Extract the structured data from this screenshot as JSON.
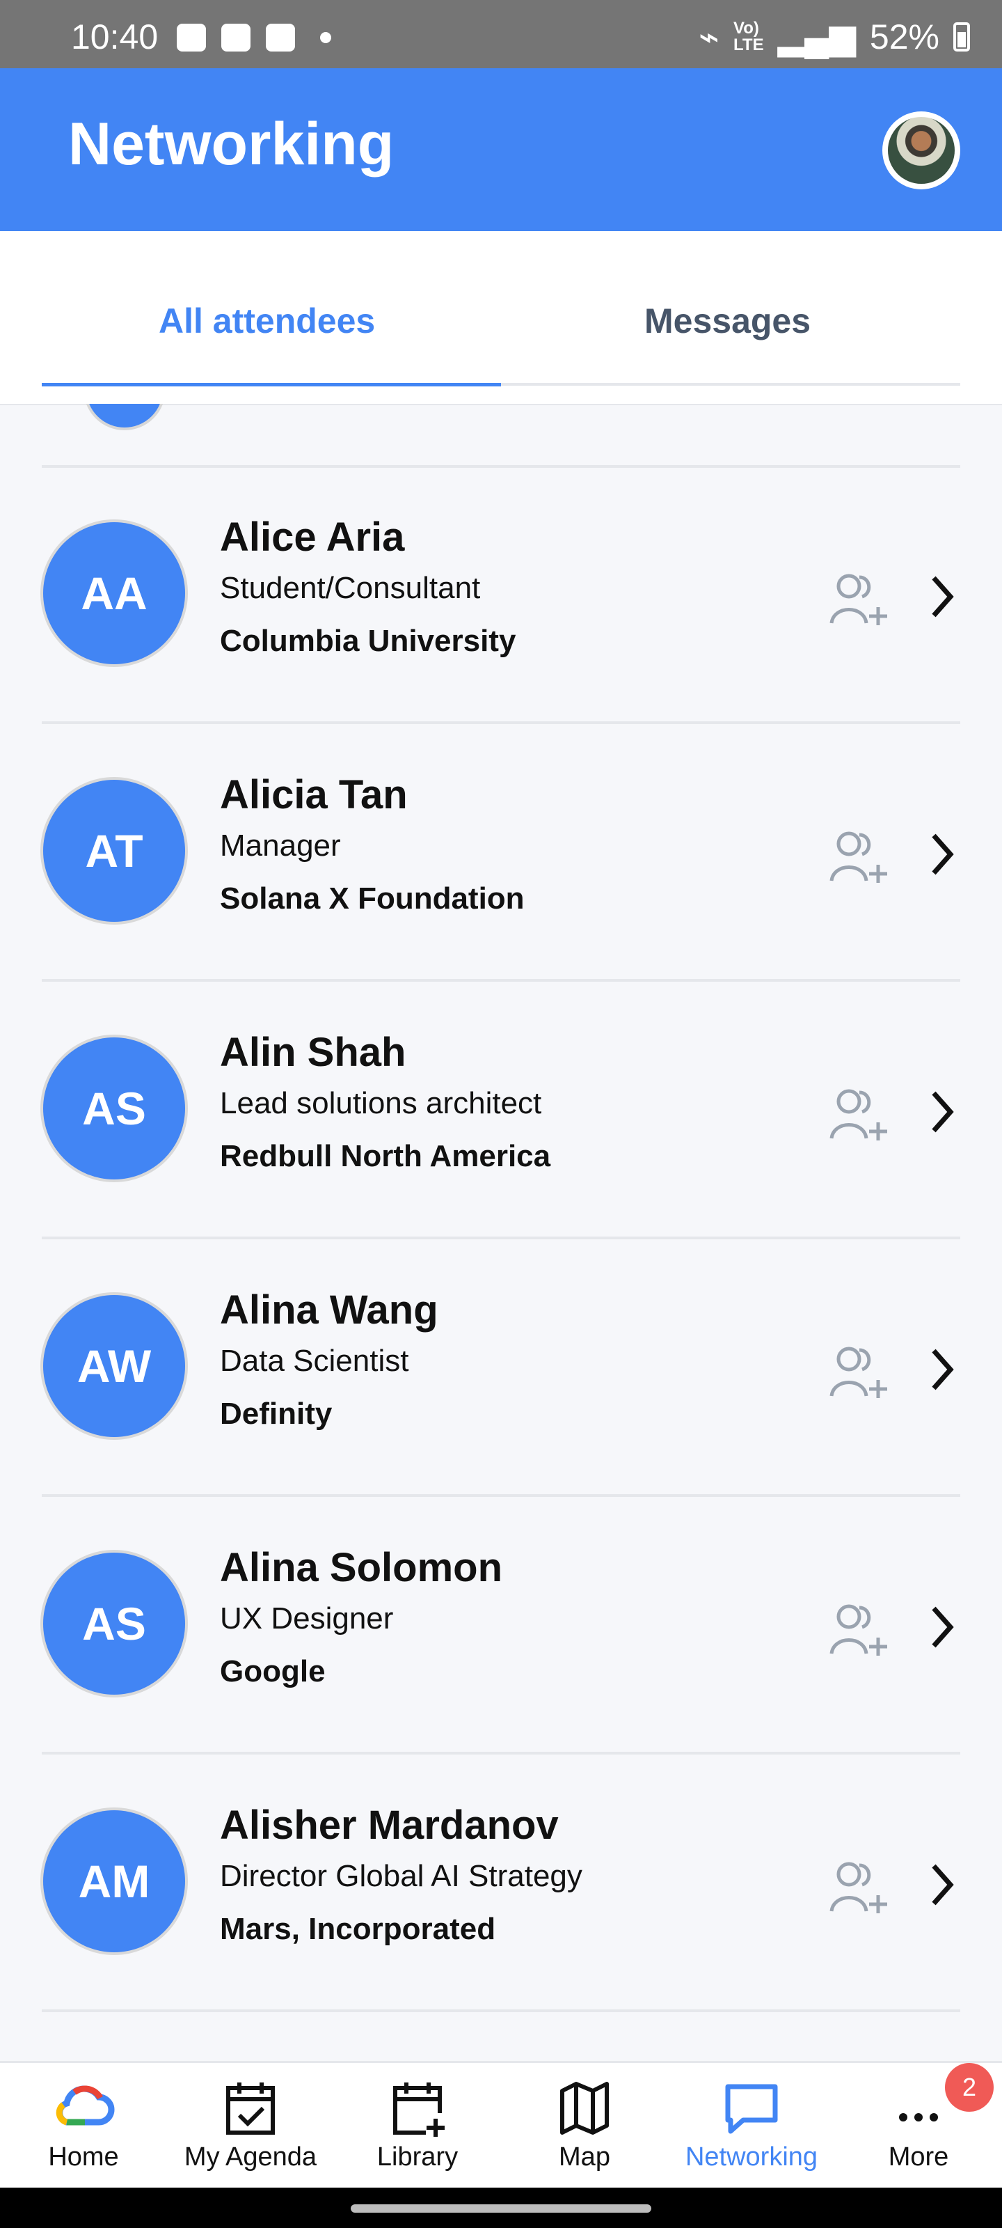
{
  "status_bar": {
    "time": "10:40",
    "battery": "52%"
  },
  "header": {
    "title": "Networking"
  },
  "tabs": [
    {
      "label": "All attendees",
      "active": true
    },
    {
      "label": "Messages",
      "active": false
    }
  ],
  "attendees": [
    {
      "initials": "AA",
      "name": "Alice Aria",
      "title": "Student/Consultant",
      "company": "Columbia University"
    },
    {
      "initials": "AT",
      "name": "Alicia Tan",
      "title": "Manager",
      "company": "Solana X Foundation"
    },
    {
      "initials": "AS",
      "name": "Alin Shah",
      "title": "Lead solutions architect",
      "company": "Redbull North America"
    },
    {
      "initials": "AW",
      "name": "Alina Wang",
      "title": "Data Scientist",
      "company": "Definity"
    },
    {
      "initials": "AS",
      "name": "Alina Solomon",
      "title": "UX Designer",
      "company": "Google"
    },
    {
      "initials": "AM",
      "name": "Alisher Mardanov",
      "title": "Director Global AI Strategy",
      "company": "Mars, Incorporated"
    }
  ],
  "bottom_nav": [
    {
      "label": "Home",
      "icon": "google-cloud-icon"
    },
    {
      "label": "My Agenda",
      "icon": "calendar-check-icon"
    },
    {
      "label": "Library",
      "icon": "calendar-plus-icon"
    },
    {
      "label": "Map",
      "icon": "map-icon"
    },
    {
      "label": "Networking",
      "icon": "chat-bubble-icon",
      "active": true
    },
    {
      "label": "More",
      "icon": "more-dots-icon",
      "badge": "2"
    }
  ],
  "colors": {
    "primary": "#4285f4",
    "badge": "#f05a56"
  }
}
